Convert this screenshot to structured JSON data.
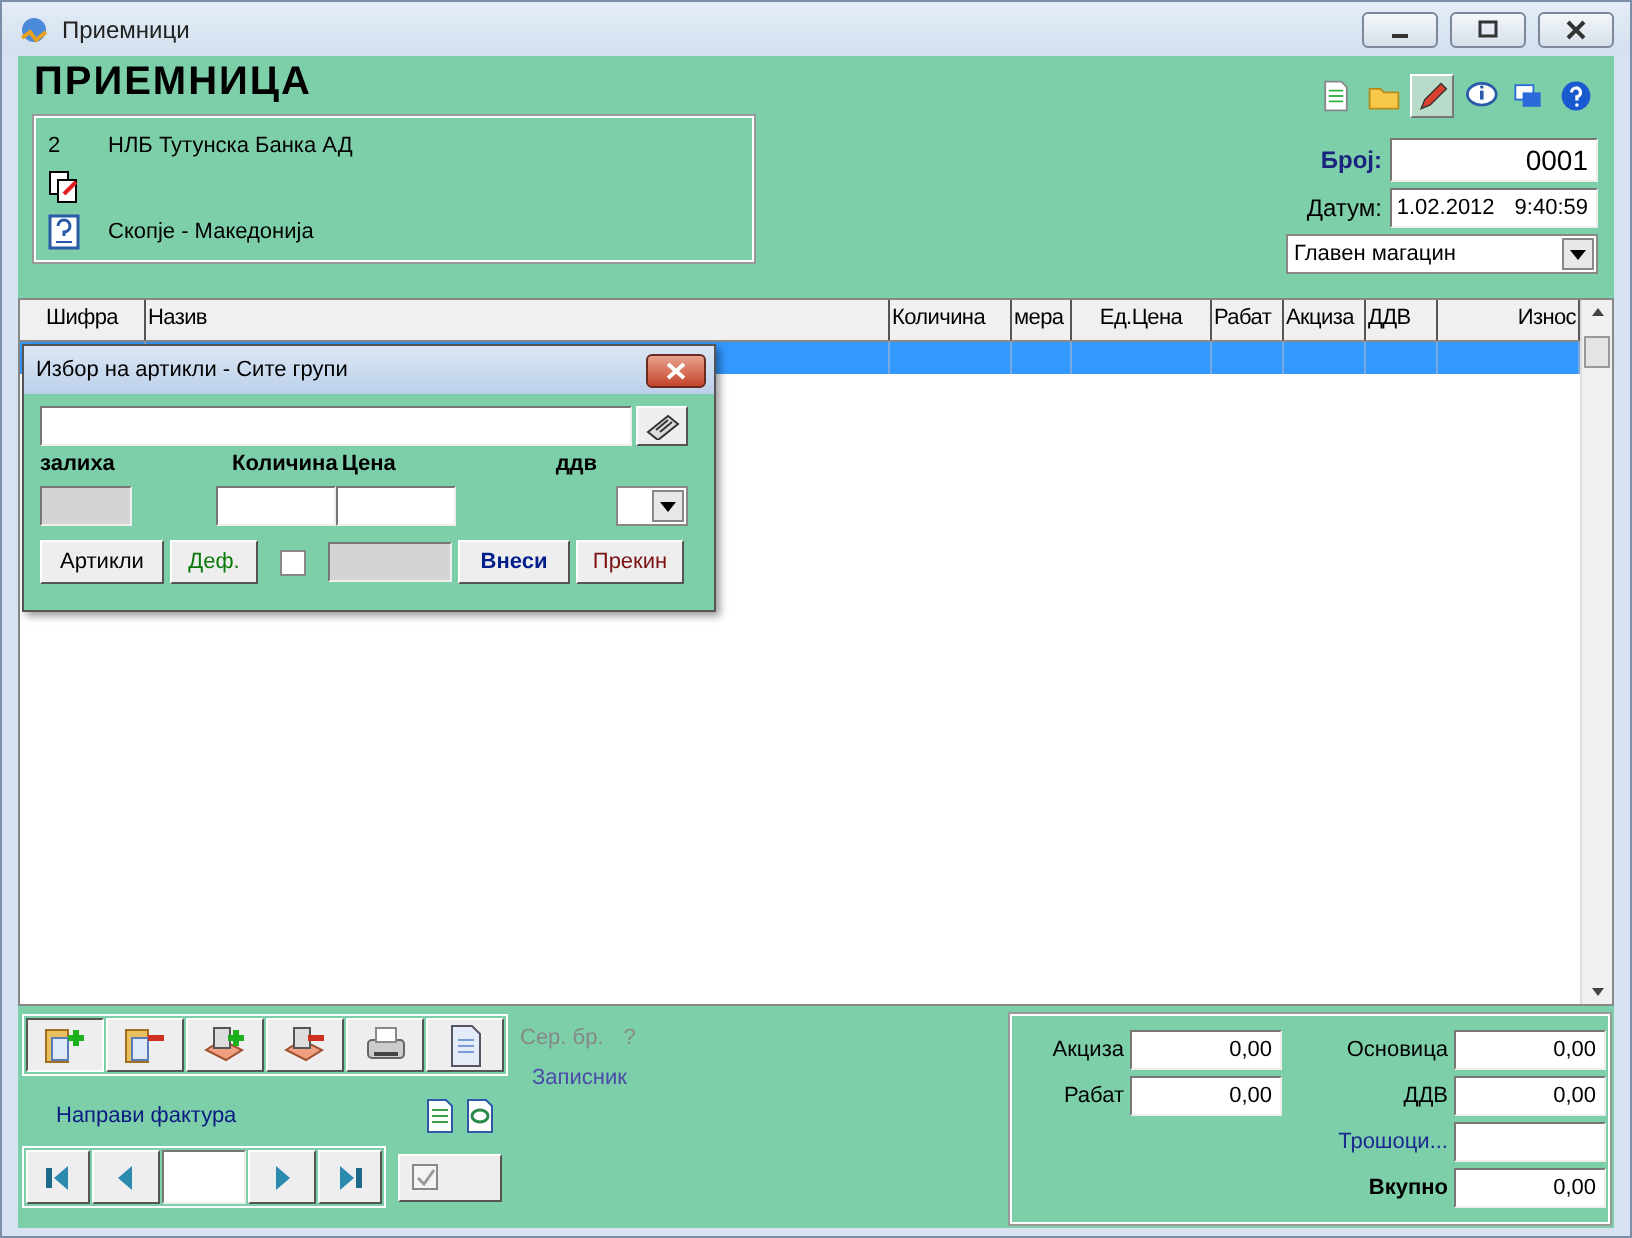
{
  "window": {
    "title": "Приемници"
  },
  "header": {
    "title": "ПРИЕМНИЦА",
    "partner": {
      "code": "2",
      "name": "НЛБ Тутунска Банка АД",
      "city": "Скопје - Македонија"
    },
    "tools": [
      {
        "kind": "new",
        "pressed": false
      },
      {
        "kind": "open",
        "pressed": false
      },
      {
        "kind": "edit",
        "pressed": true
      },
      {
        "kind": "info",
        "pressed": false
      },
      {
        "kind": "windows",
        "pressed": false
      },
      {
        "kind": "help",
        "pressed": false
      }
    ],
    "number_label": "Број:",
    "number": "0001",
    "date_label": "Датум:",
    "date": "1.02.2012",
    "time": "9:40:59",
    "warehouse": "Главен магацин"
  },
  "table": {
    "columns": [
      "Шифра",
      "Назив",
      "Количина",
      "мера",
      "Ед.Цена",
      "Рабат",
      "Акциза",
      "ДДВ",
      "Износ"
    ],
    "rows": [
      {
        "selected": true
      }
    ]
  },
  "dialog": {
    "title": "Избор на артикли - Сите групи",
    "stock_label": "залиха",
    "qty_label": "Количина",
    "price_label": "Цена",
    "vat_label": "ддв",
    "default_checked": false,
    "buttons": [
      {
        "label": "Артикли",
        "kind": "plain"
      },
      {
        "label": "Деф.",
        "kind": "green"
      },
      {
        "label": "Внеси",
        "kind": "bold"
      },
      {
        "label": "Прекин",
        "kind": "red"
      }
    ]
  },
  "bottom": {
    "actions": [
      {
        "kind": "add-doc",
        "pressed": true
      },
      {
        "kind": "remove-doc",
        "pressed": false
      },
      {
        "kind": "add-box",
        "pressed": false
      },
      {
        "kind": "remove-box",
        "pressed": false
      },
      {
        "kind": "print",
        "pressed": false
      },
      {
        "kind": "page",
        "pressed": false
      }
    ],
    "serial_label": "Сер. бр.",
    "serial_value": "?",
    "notes_link": "Записник",
    "invoice_link": "Направи фактура",
    "confirmed_checked": true,
    "totals": [
      {
        "label": "Акциза",
        "value": "0,00",
        "kind": "plain"
      },
      {
        "label": "Основица",
        "value": "0,00",
        "kind": "plain"
      },
      {
        "label": "Рабат",
        "value": "0,00",
        "kind": "plain"
      },
      {
        "label": "ДДВ",
        "value": "0,00",
        "kind": "plain"
      },
      {
        "label": "Трошоци...",
        "kind": "link"
      },
      {
        "label": "Вкупно",
        "value": "0,00",
        "kind": "bold"
      }
    ]
  }
}
